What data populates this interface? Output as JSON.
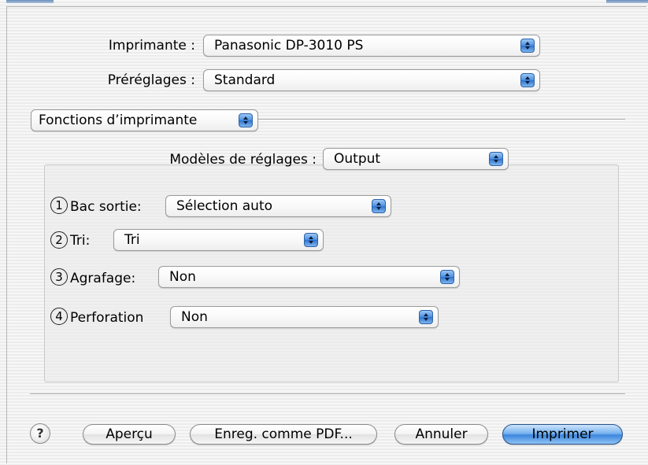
{
  "printer": {
    "label": "Imprimante :",
    "value": "Panasonic DP-3010 PS"
  },
  "presets": {
    "label": "Préréglages :",
    "value": "Standard"
  },
  "panel_menu": {
    "value": "Fonctions d’imprimante"
  },
  "feature_sets": {
    "label": "Modèles de réglages :",
    "value": "Output"
  },
  "options": [
    {
      "marker": "1",
      "label": "Bac sortie:",
      "value": "Sélection auto"
    },
    {
      "marker": "2",
      "label": "Tri:",
      "value": "Tri"
    },
    {
      "marker": "3",
      "label": "Agrafage:",
      "value": "Non"
    },
    {
      "marker": "4",
      "label": "Perforation",
      "value": "Non"
    }
  ],
  "buttons": {
    "help": "?",
    "preview": "Aperçu",
    "save_pdf": "Enreg. comme PDF...",
    "cancel": "Annuler",
    "print": "Imprimer"
  },
  "colors": {
    "default_button": "#4a8ee0",
    "popup_arrow": "#2e72cc"
  }
}
